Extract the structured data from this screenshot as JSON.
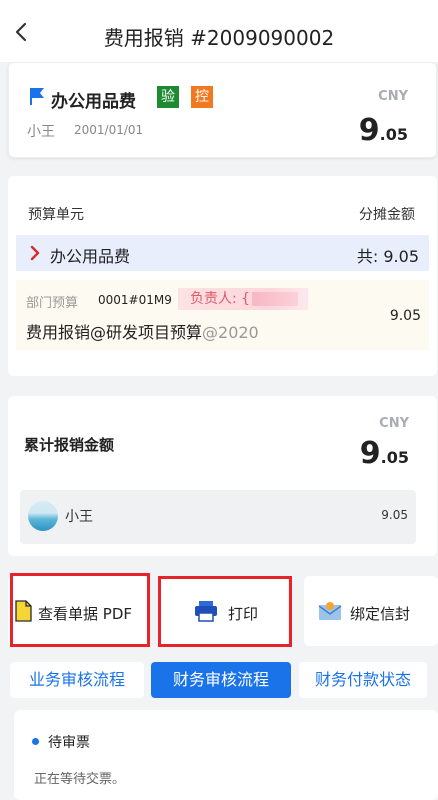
{
  "header": {
    "title": "费用报销 #2009090002"
  },
  "summary": {
    "title": "办公用品费",
    "badges": [
      "验",
      "控"
    ],
    "currency": "CNY",
    "user": "小王",
    "date": "2001/01/01",
    "amount_int": "9",
    "amount_dec": ".05"
  },
  "budget": {
    "col_left": "预算单元",
    "col_right": "分摊金额",
    "category": "办公用品费",
    "total": "共: 9.05",
    "dept_label": "部门预算",
    "dept_code": "0001#01M9",
    "owner_label": "负责人: ",
    "owner_visible": "{",
    "item_title": "费用报销@研发项目预算",
    "item_year": "@2020",
    "item_amount": "9.05"
  },
  "cumulative": {
    "currency": "CNY",
    "label": "累计报销金额",
    "amount_int": "9",
    "amount_dec": ".05",
    "user": "小王",
    "user_amount": "9.05"
  },
  "actions": {
    "view_pdf": "查看单据 PDF",
    "print": "打印",
    "bind_envelope": "绑定信封"
  },
  "tabs": [
    {
      "label": "业务审核流程",
      "active": false
    },
    {
      "label": "财务审核流程",
      "active": true
    },
    {
      "label": "财务付款状态",
      "active": false
    }
  ],
  "flow": {
    "status": "待审票",
    "note": "正在等待交票。"
  },
  "colors": {
    "accent": "#1a73e8",
    "highlight_border": "#e8242b",
    "badge_green": "#1e8b32",
    "badge_orange": "#f2791f"
  }
}
